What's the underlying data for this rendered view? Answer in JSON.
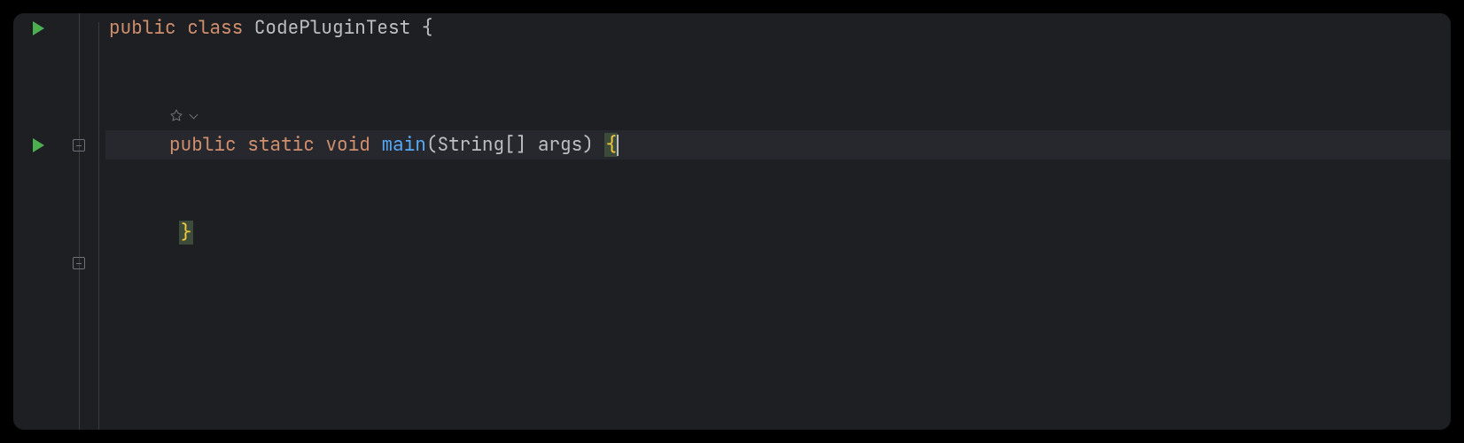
{
  "code": {
    "line1": {
      "kw_public": "public",
      "kw_class": "class",
      "class_name": "CodePluginTest",
      "brace_open": "{"
    },
    "line4": {
      "kw_public": "public",
      "kw_static": "static",
      "kw_void": "void",
      "method_name": "main",
      "params": "(String[] args)",
      "brace_open": "{"
    },
    "line6": {
      "brace_close": "}"
    }
  },
  "gutter": {
    "run_class": "run-class",
    "run_method": "run-main"
  }
}
